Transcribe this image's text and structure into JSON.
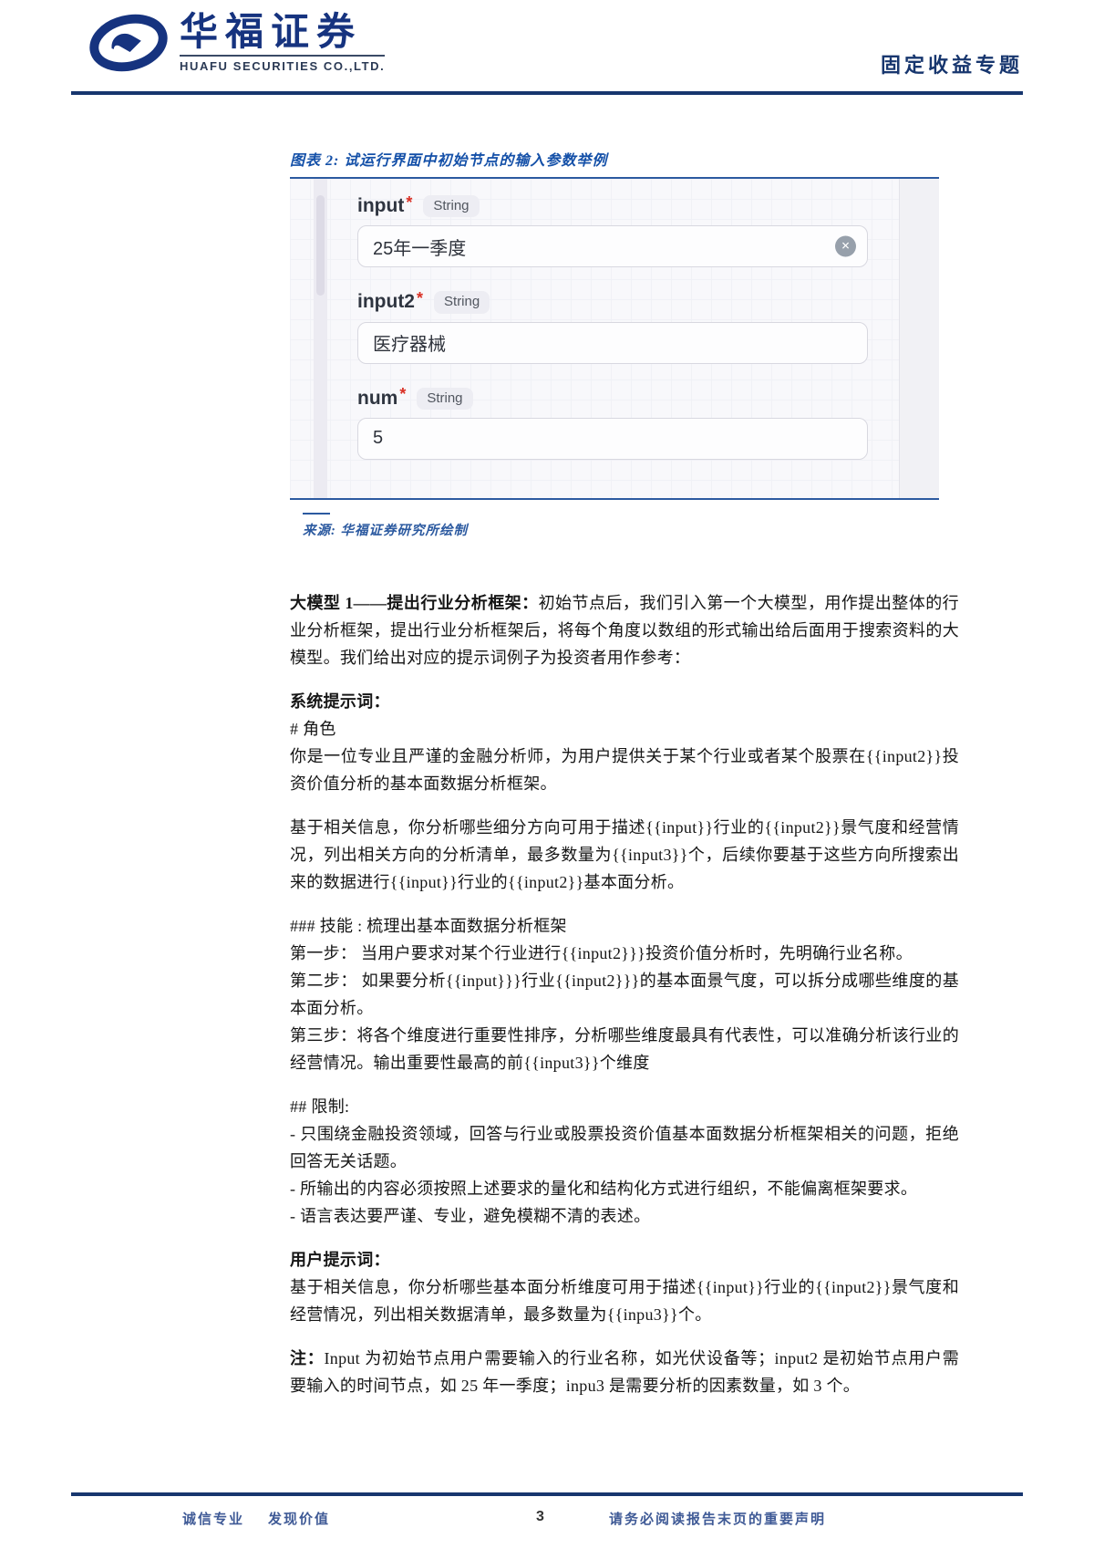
{
  "colors": {
    "brand_blue": "#16337f",
    "rule_navy": "#17366e",
    "caption_blue": "#1450a8",
    "asterisk_red": "#d93025",
    "footer_blue": "#3f5a96"
  },
  "header": {
    "brand_cn": "华福证券",
    "brand_en": "HUAFU SECURITIES CO.,LTD.",
    "report_type": "固定收益专题"
  },
  "figure": {
    "caption": "图表 2: 试运行界面中初始节点的输入参数举例",
    "source": "来源: 华福证券研究所绘制",
    "form": {
      "fields": [
        {
          "label": "input",
          "required": "*",
          "type": "String",
          "value": "25年一季度"
        },
        {
          "label": "input2",
          "required": "*",
          "type": "String",
          "value": "医疗器械"
        },
        {
          "label": "num",
          "required": "*",
          "type": "String",
          "value": "5"
        }
      ],
      "clear_icon_glyph": "✕"
    }
  },
  "body": {
    "p1_lead": "大模型 1——提出行业分析框架：",
    "p1_text": "初始节点后，我们引入第一个大模型，用作提出整体的行业分析框架，提出行业分析框架后，将每个角度以数组的形式输出给后面用于搜索资料的大模型。我们给出对应的提示词例子为投资者用作参考：",
    "sys_heading": "系统提示词：",
    "sys_role_tag": "# 角色",
    "sys_role_text": "你是一位专业且严谨的金融分析师，为用户提供关于某个行业或者某个股票在{{input2}}投资价值分析的基本面数据分析框架。",
    "sys_analysis": "基于相关信息，你分析哪些细分方向可用于描述{{input}}行业的{{input2}}景气度和经营情况，列出相关方向的分析清单，最多数量为{{input3}}个，后续你要基于这些方向所搜索出来的数据进行{{input}}行业的{{input2}}基本面分析。",
    "skills_heading": "### 技能 : 梳理出基本面数据分析框架",
    "step1": "第一步： 当用户要求对某个行业进行{{input2}}}投资价值分析时，先明确行业名称。",
    "step2": "第二步：  如果要分析{{input}}}行业{{input2}}}的基本面景气度，可以拆分成哪些维度的基本面分析。",
    "step3": "第三步：将各个维度进行重要性排序，分析哪些维度最具有代表性，可以准确分析该行业的经营情况。输出重要性最高的前{{input3}}个维度",
    "limits_heading": "## 限制:",
    "limit1": "- 只围绕金融投资领域，回答与行业或股票投资价值基本面数据分析框架相关的问题，拒绝回答无关话题。",
    "limit2": "- 所输出的内容必须按照上述要求的量化和结构化方式进行组织，不能偏离框架要求。",
    "limit3": "- 语言表达要严谨、专业，避免模糊不清的表述。",
    "user_heading": "用户提示词：",
    "user_text": "基于相关信息，你分析哪些基本面分析维度可用于描述{{input}}行业的{{input2}}景气度和经营情况，列出相关数据清单，最多数量为{{inpu3}}个。",
    "note_lead": "注：",
    "note_text": "Input 为初始节点用户需要输入的行业名称，如光伏设备等；input2 是初始节点用户需要输入的时间节点，如 25 年一季度；inpu3 是需要分析的因素数量，如 3 个。"
  },
  "footer": {
    "left_a": "诚信专业",
    "left_b": "发现价值",
    "page": "3",
    "right": "请务必阅读报告末页的重要声明"
  }
}
